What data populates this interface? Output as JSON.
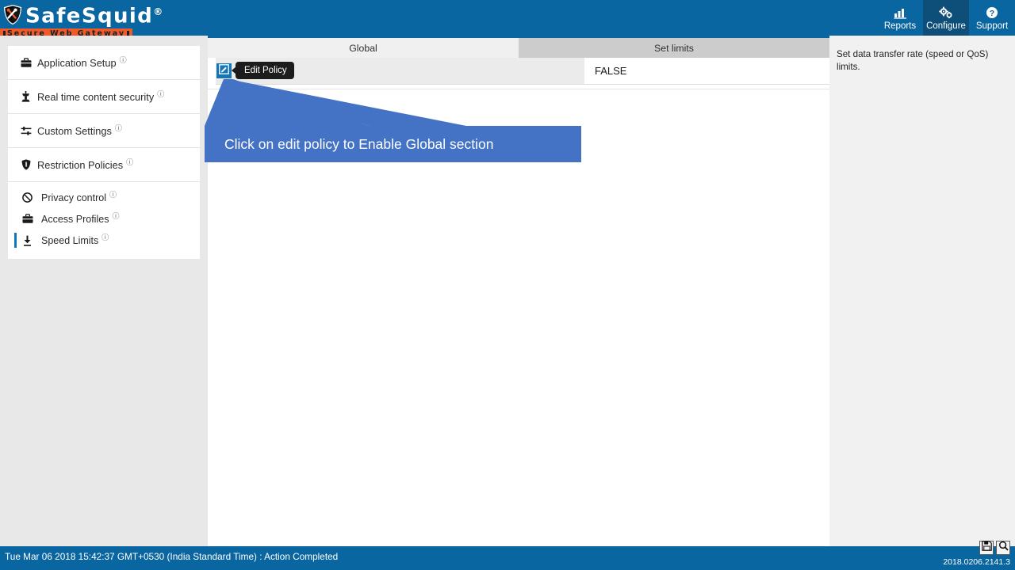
{
  "app": {
    "brand_name": "SafeSquid",
    "brand_reg": "®",
    "brand_tagline": "Secure Web Gateway",
    "logo_icon": "shield-tools-icon"
  },
  "nav": {
    "items": [
      {
        "label": "Reports",
        "icon": "chart-icon",
        "active": false
      },
      {
        "label": "Configure",
        "icon": "gears-icon",
        "active": true
      },
      {
        "label": "Support",
        "icon": "question-circle-icon",
        "active": false
      }
    ]
  },
  "sidebar": {
    "groups": [
      {
        "items": [
          {
            "label": "Application Setup",
            "icon": "briefcase-icon",
            "badge": "ⓘ"
          }
        ]
      },
      {
        "items": [
          {
            "label": "Real time content security",
            "icon": "tower-shield-icon",
            "badge": "ⓘ"
          }
        ]
      },
      {
        "items": [
          {
            "label": "Custom Settings",
            "icon": "sliders-icon",
            "badge": "ⓘ"
          }
        ]
      },
      {
        "items": [
          {
            "label": "Restriction Policies",
            "icon": "shield-icon",
            "badge": "ⓘ"
          }
        ]
      },
      {
        "items": [
          {
            "label": "Privacy control",
            "icon": "ban-circle-icon",
            "badge": "ⓘ"
          },
          {
            "label": "Access Profiles",
            "icon": "briefcase-icon",
            "badge": "ⓘ"
          },
          {
            "label": "Speed Limits",
            "icon": "download-speed-icon",
            "badge": "ⓘ",
            "selected": true
          }
        ]
      }
    ]
  },
  "tabs": [
    {
      "label": "Global",
      "active": true
    },
    {
      "label": "Set limits",
      "active": false
    }
  ],
  "content": {
    "edit_icon": "pencil-square-icon",
    "tooltip": "Edit Policy",
    "value": "FALSE"
  },
  "annotation": {
    "text": "Click on edit policy to Enable Global section",
    "color": "#4472c4"
  },
  "right_panel": {
    "help_text": "Set data transfer rate (speed or QoS) limits."
  },
  "toolbar": {
    "save_icon": "floppy-save-icon",
    "search_icon": "magnifier-search-icon"
  },
  "footer": {
    "status": "Tue Mar 06 2018 15:42:37 GMT+0530 (India Standard Time) : Action Completed",
    "version": "2018.0206.2141.3"
  },
  "colors": {
    "header_blue": "#0a66a0",
    "accent_blue": "#1576b5",
    "brand_orange": "#f05a28",
    "annotation_blue": "#4472c4",
    "tab_active": "#f0f0f0",
    "tab_inactive": "#cccccc"
  }
}
